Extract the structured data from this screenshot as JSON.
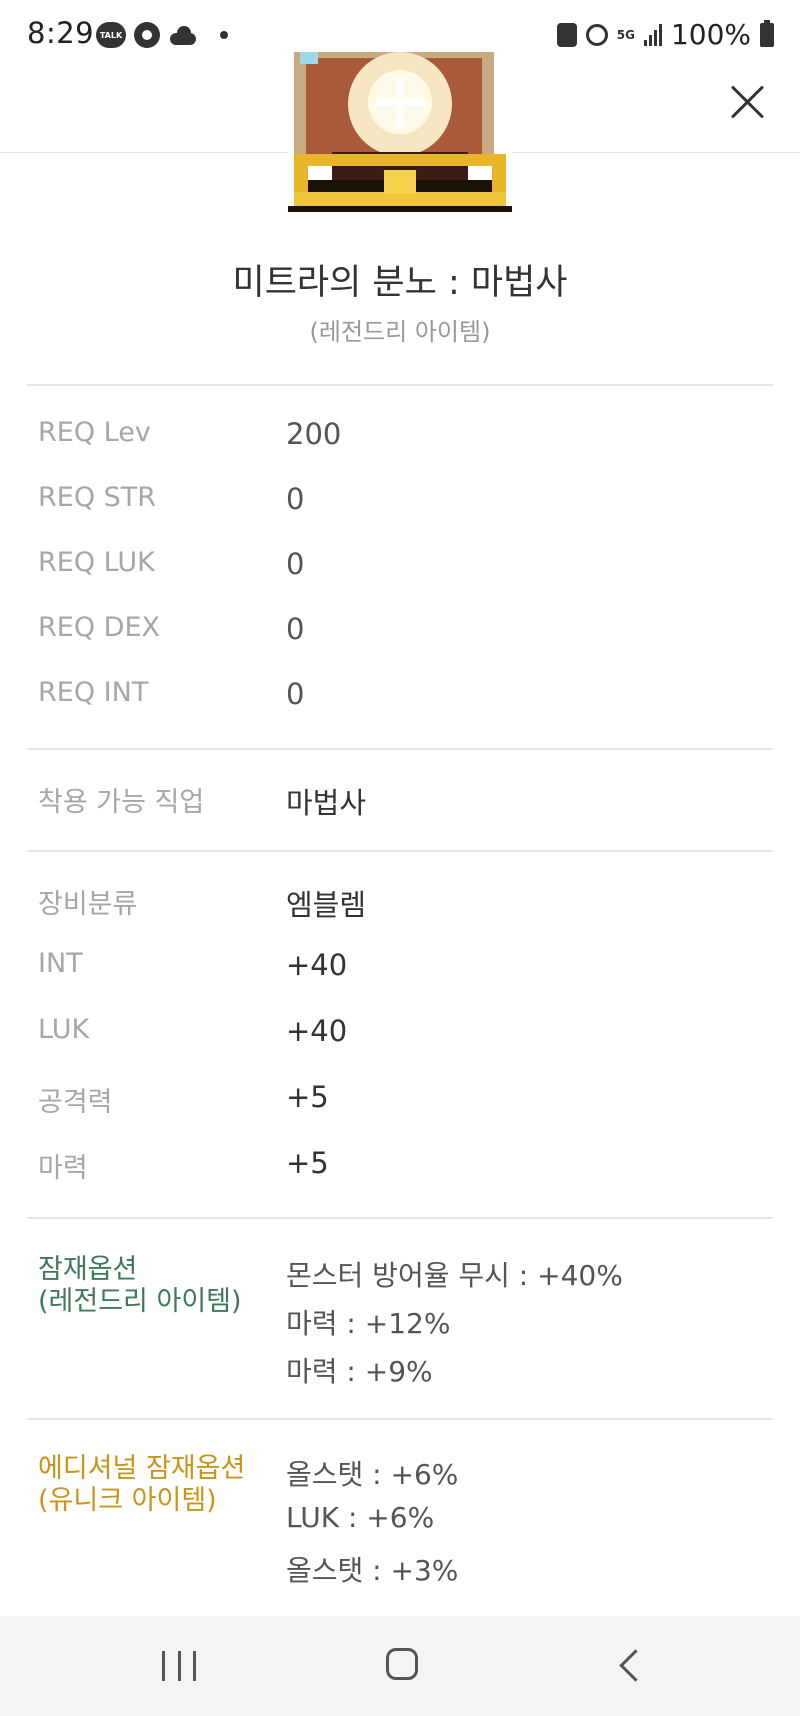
{
  "status_bar": {
    "time": "8:29",
    "talk_badge": "TALK",
    "network": "5G",
    "battery": "100%"
  },
  "item": {
    "title": "미트라의 분노 : 마법사",
    "grade": "(레전드리 아이템)"
  },
  "requirements": [
    {
      "label": "REQ Lev",
      "value": "200"
    },
    {
      "label": "REQ STR",
      "value": "0"
    },
    {
      "label": "REQ LUK",
      "value": "0"
    },
    {
      "label": "REQ DEX",
      "value": "0"
    },
    {
      "label": "REQ INT",
      "value": "0"
    }
  ],
  "job": {
    "label": "착용 가능 직업",
    "value": "마법사"
  },
  "stats": [
    {
      "label": "장비분류",
      "value": "엠블렘"
    },
    {
      "label": "INT",
      "value": "+40"
    },
    {
      "label": "LUK",
      "value": "+40"
    },
    {
      "label": "공격력",
      "value": "+5"
    },
    {
      "label": "마력",
      "value": "+5"
    }
  ],
  "potential": {
    "label_line1": "잠재옵션",
    "label_line2": "(레전드리 아이템)",
    "color": "#3e7a5a",
    "options": [
      "몬스터 방어율 무시 : +40%",
      "마력 : +12%",
      "마력 : +9%"
    ]
  },
  "additional_potential": {
    "label_line1": "에디셔널 잠재옵션",
    "label_line2": "(유니크 아이템)",
    "color": "#c9941a",
    "options": [
      "올스탯 : +6%",
      "LUK : +6%",
      "올스탯 : +3%"
    ]
  }
}
